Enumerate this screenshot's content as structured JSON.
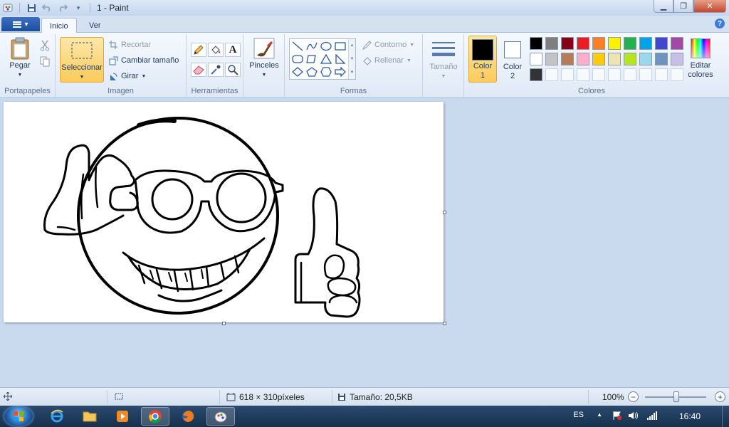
{
  "window": {
    "title": "1 - Paint"
  },
  "tabs": [
    {
      "label": "Inicio"
    },
    {
      "label": "Ver"
    }
  ],
  "ribbon": {
    "portapapeles": {
      "paste_label": "Pegar",
      "group_label": "Portapapeles"
    },
    "imagen": {
      "select_label": "Seleccionar",
      "crop_label": "Recortar",
      "resize_label": "Cambiar tamaño",
      "rotate_label": "Girar",
      "group_label": "Imagen"
    },
    "herramientas": {
      "group_label": "Herramientas"
    },
    "pinceles": {
      "label": "Pinceles"
    },
    "formas": {
      "outline_label": "Contorno",
      "fill_label": "Rellenar",
      "group_label": "Formas"
    },
    "tamano": {
      "label": "Tamaño"
    },
    "colores": {
      "color1_label": "Color",
      "color1_num": "1",
      "color2_label": "Color",
      "color2_num": "2",
      "edit_label_1": "Editar",
      "edit_label_2": "colores",
      "group_label": "Colores",
      "color1_value": "#000000",
      "color2_value": "#ffffff",
      "palette_row1": [
        "#000000",
        "#7f7f7f",
        "#880015",
        "#ed1c24",
        "#ff7f27",
        "#fff200",
        "#22b14c",
        "#00a2e8",
        "#3f48cc",
        "#a349a4"
      ],
      "palette_row2": [
        "#ffffff",
        "#c3c3c3",
        "#b97a57",
        "#ffaec9",
        "#ffc90e",
        "#efe4b0",
        "#b5e61d",
        "#99d9ea",
        "#7092be",
        "#c8bfe7"
      ],
      "palette_row3": [
        "#333333"
      ]
    }
  },
  "status": {
    "dimensions": "618 × 310píxeles",
    "size": "Tamaño: 20,5KB",
    "zoom": "100%",
    "zoom_level": 1.0
  },
  "taskbar": {
    "language": "ES",
    "time": "16:40"
  },
  "accent_colors": {
    "selected_bg": "#fbcb5c",
    "ribbon_bg": "#f5f9fe",
    "workspace_bg": "#c9d9ee"
  }
}
